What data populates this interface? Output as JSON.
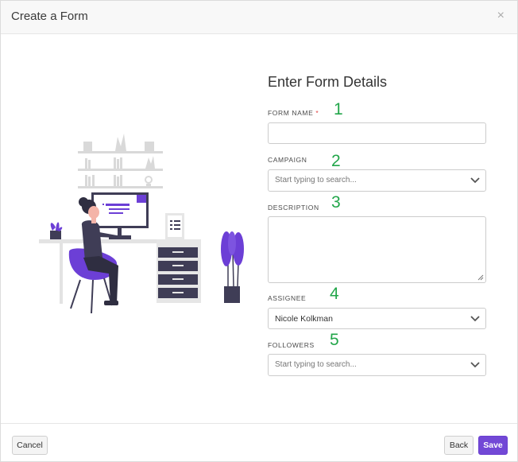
{
  "modal": {
    "title": "Create a Form",
    "close_glyph": "×"
  },
  "form": {
    "heading": "Enter Form Details",
    "fields": [
      {
        "label": "FORM NAME",
        "required_mark": "*",
        "marker": "1",
        "value": "",
        "placeholder": ""
      },
      {
        "label": "CAMPAIGN",
        "marker": "2",
        "placeholder": "Start typing to search..."
      },
      {
        "label": "DESCRIPTION",
        "marker": "3",
        "value": ""
      },
      {
        "label": "ASSIGNEE",
        "marker": "4",
        "value": "Nicole Kolkman"
      },
      {
        "label": "FOLLOWERS",
        "marker": "5",
        "placeholder": "Start typing to search..."
      }
    ]
  },
  "footer": {
    "cancel_label": "Cancel",
    "back_label": "Back",
    "save_label": "Save"
  },
  "colors": {
    "accent": "#7248d6",
    "marker": "#22a64a",
    "required": "#e04545"
  },
  "icons": [
    "close-icon",
    "chevron-down-icon",
    "resize-grip-icon",
    "workspace-illustration"
  ]
}
